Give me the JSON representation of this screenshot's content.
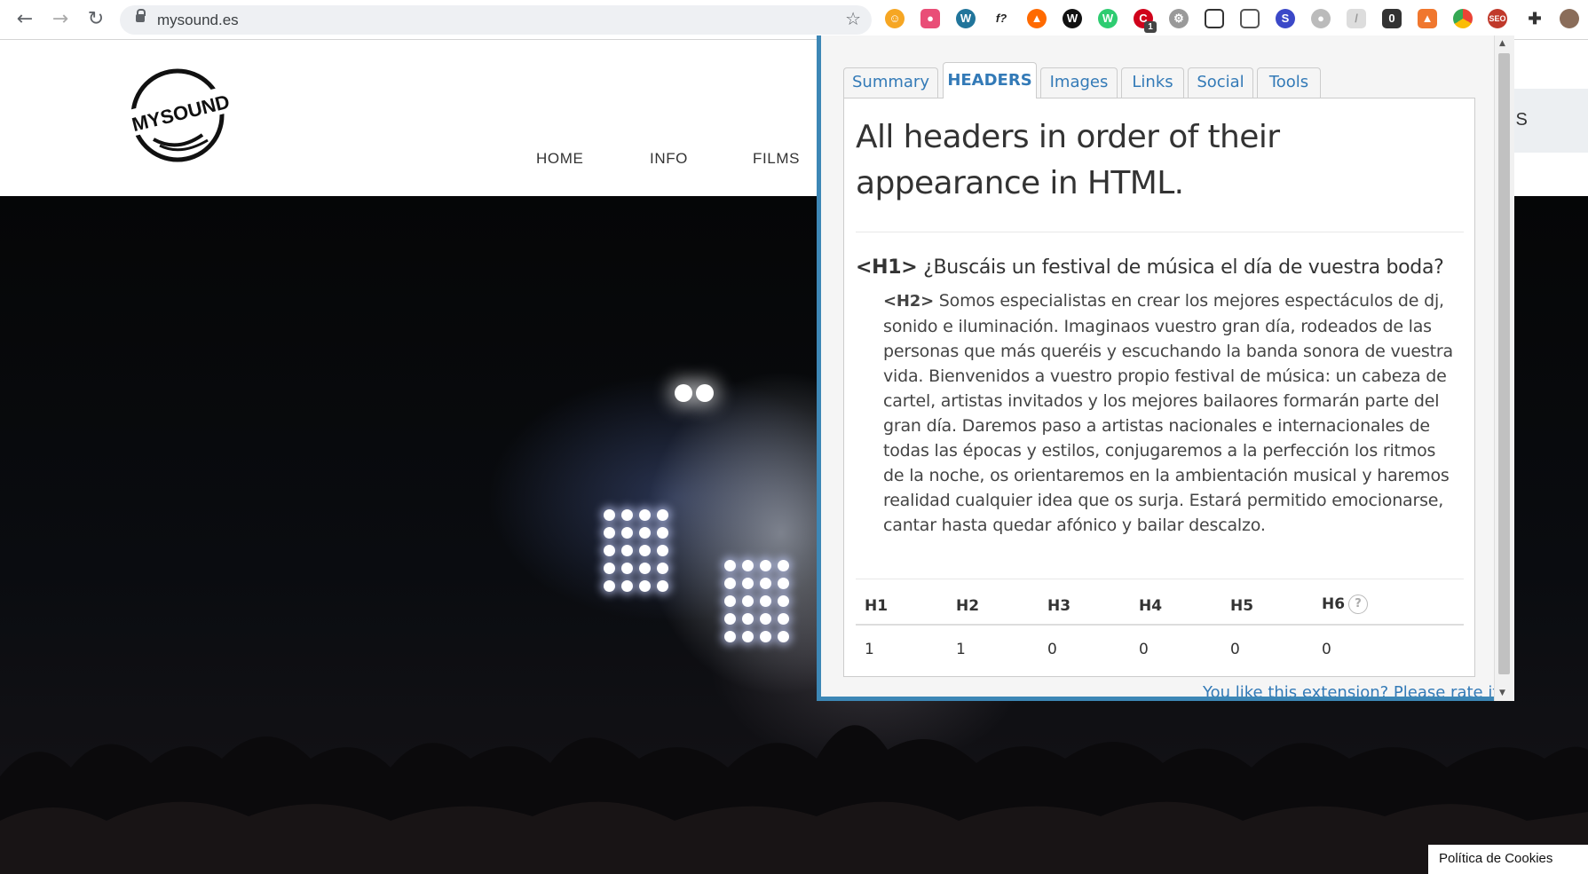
{
  "browser": {
    "url": "mysound.es",
    "extension_badge": "1"
  },
  "site": {
    "logo_text": "MYSOUND",
    "nav": [
      "HOME",
      "INFO",
      "FILMS"
    ],
    "cta_partial": "RS",
    "cookies_label": "Política de Cookies"
  },
  "popup": {
    "tabs": [
      "Summary",
      "HEADERS",
      "Images",
      "Links",
      "Social",
      "Tools"
    ],
    "active_tab": "HEADERS",
    "title": "All headers in order of their appearance in HTML.",
    "h1": {
      "tag": "<H1>",
      "text": "¿Buscáis un festival de música el día de vuestra boda?"
    },
    "h2": {
      "tag": "<H2>",
      "text": "Somos especialistas en crear los mejores espectáculos de dj, sonido e iluminación. Imaginaos vuestro gran día, rodeados de las personas que más queréis y escuchando la banda sonora de vuestra vida. Bienvenidos a vuestro propio festival de música: un cabeza de cartel, artistas invitados y los mejores bailaores formarán parte del gran día. Daremos paso a artistas nacionales e internacionales de todas las épocas y estilos, conjugaremos a la perfección los ritmos de la noche, os orientaremos en la ambientación musical y haremos realidad cualquier idea que os surja. Estará permitido emocionarse, cantar hasta quedar afónico y bailar descalzo."
    },
    "table": {
      "headers": [
        "H1",
        "H2",
        "H3",
        "H4",
        "H5",
        "H6"
      ],
      "values": [
        "1",
        "1",
        "0",
        "0",
        "0",
        "0"
      ],
      "help_glyph": "?"
    },
    "rate_link": "You like this extension? Please rate it!"
  },
  "colors": {
    "accent": "#3d87b6",
    "link": "#337ab7"
  }
}
